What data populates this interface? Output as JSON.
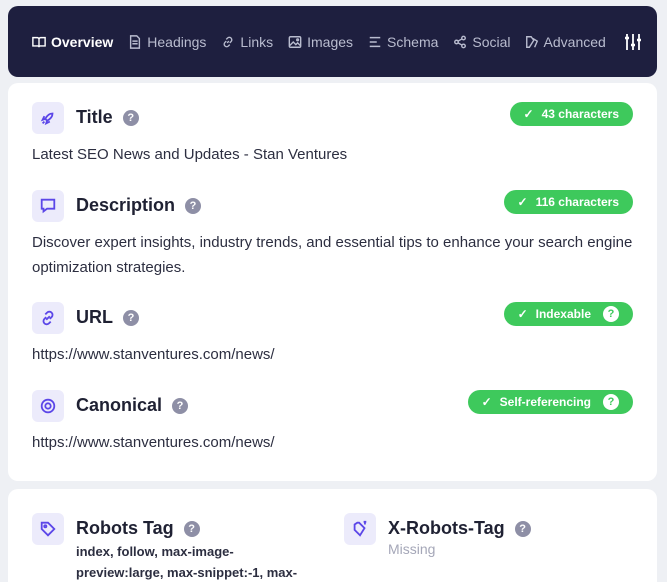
{
  "nav": {
    "tabs": [
      {
        "label": "Overview",
        "icon": "book-icon",
        "active": true
      },
      {
        "label": "Headings",
        "icon": "document-icon",
        "active": false
      },
      {
        "label": "Links",
        "icon": "link-icon",
        "active": false
      },
      {
        "label": "Images",
        "icon": "image-icon",
        "active": false
      },
      {
        "label": "Schema",
        "icon": "list-icon",
        "active": false
      },
      {
        "label": "Social",
        "icon": "share-icon",
        "active": false
      },
      {
        "label": "Advanced",
        "icon": "advanced-icon",
        "active": false
      }
    ],
    "settings_icon": "sliders-icon"
  },
  "colors": {
    "nav_bg": "#1e1f3f",
    "accent": "#5b46e8",
    "success": "#3ec95c"
  },
  "overview": {
    "title": {
      "heading": "Title",
      "badge": "43 characters",
      "value": "Latest SEO News and Updates - Stan Ventures"
    },
    "description": {
      "heading": "Description",
      "badge": "116 characters",
      "value": "Discover expert insights, industry trends, and essential tips to enhance your search engine optimization strategies."
    },
    "url": {
      "heading": "URL",
      "badge": "Indexable",
      "value": "https://www.stanventures.com/news/"
    },
    "canonical": {
      "heading": "Canonical",
      "badge": "Self-referencing",
      "value": "https://www.stanventures.com/news/"
    }
  },
  "robots": {
    "robots_tag": {
      "heading": "Robots Tag",
      "value": "index, follow, max-image-preview:large, max-snippet:-1, max-"
    },
    "x_robots_tag": {
      "heading": "X-Robots-Tag",
      "value": "Missing"
    }
  },
  "help_glyph": "?",
  "check_glyph": "✓"
}
